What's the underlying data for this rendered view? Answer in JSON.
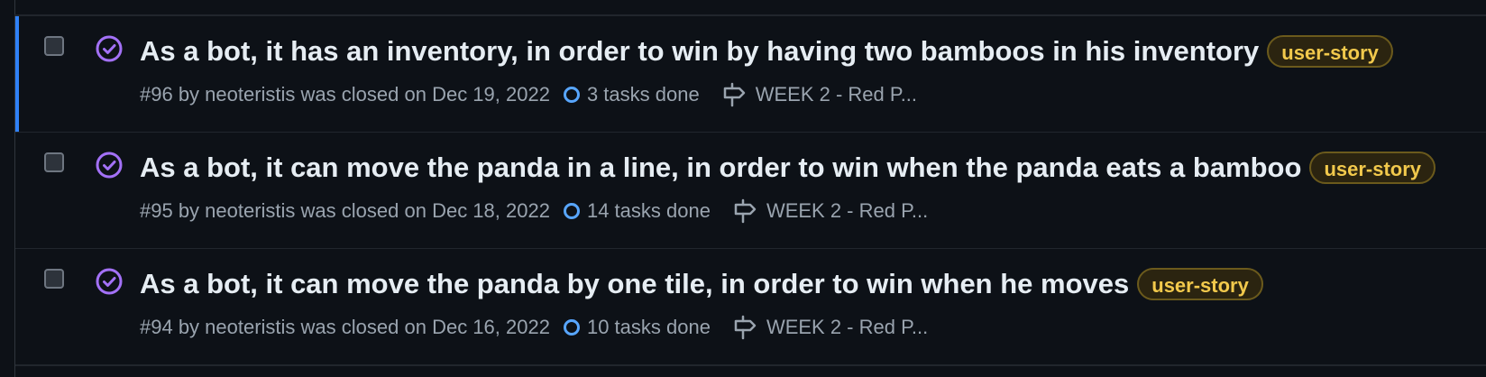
{
  "colors": {
    "background": "#0d1117",
    "title_text": "#e6edf3",
    "meta_text": "#9aa4af",
    "closed_icon": "#a371f7",
    "task_ring": "#58a6ff",
    "label_text": "#f2c94c",
    "selected_accent": "#2f81f7"
  },
  "issues": [
    {
      "title": "As a bot, it has an inventory, in order to win by having two bamboos in his inventory",
      "label": "user-story",
      "meta": "#96 by neoteristis was closed on Dec 19, 2022",
      "tasks": "3 tasks done",
      "milestone": "WEEK 2 - Red P...",
      "status_icon": "closed-issue-icon",
      "selected": true
    },
    {
      "title": "As a bot, it can move the panda in a line, in order to win when the panda eats a bamboo",
      "label": "user-story",
      "meta": "#95 by neoteristis was closed on Dec 18, 2022",
      "tasks": "14 tasks done",
      "milestone": "WEEK 2 - Red P...",
      "status_icon": "closed-issue-icon",
      "selected": false
    },
    {
      "title": "As a bot, it can move the panda by one tile, in order to win when he moves",
      "label": "user-story",
      "meta": "#94 by neoteristis was closed on Dec 16, 2022",
      "tasks": "10 tasks done",
      "milestone": "WEEK 2 - Red P...",
      "status_icon": "closed-issue-icon",
      "selected": false
    }
  ]
}
